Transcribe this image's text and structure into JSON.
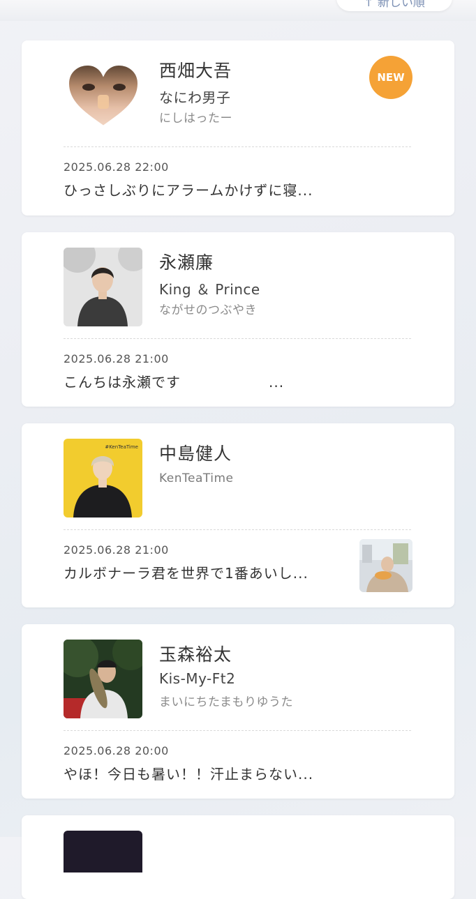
{
  "header": {
    "sort_label": "↑ 新しい順"
  },
  "cards": [
    {
      "name": "西畑大吾",
      "group": "なにわ男子",
      "handle": "にしはったー",
      "date": "2025.06.28 22:00",
      "message": "ひっさしぶりにアラームかけずに寝...",
      "badge": "NEW"
    },
    {
      "name": "永瀬廉",
      "group": "King ＆ Prince",
      "handle": "ながせのつぶやき",
      "date": "2025.06.28 21:00",
      "message": "こんちは永瀬です　　　　　　..."
    },
    {
      "name": "中島健人",
      "group": "KenTeaTime",
      "handle": "",
      "date": "2025.06.28 21:00",
      "message": "カルボナーラ君を世界で1番あいし...",
      "avatar_caption": "#KenTeaTime"
    },
    {
      "name": "玉森裕太",
      "group": "Kis-My-Ft2",
      "handle": "まいにちたまもりゆうた",
      "date": "2025.06.28 20:00",
      "message": "やほ！今日も暑い！！汗止まらない..."
    }
  ],
  "colors": {
    "badge": "#f5a236",
    "card_bg": "#ffffff",
    "page_bg": "#eceef3"
  }
}
